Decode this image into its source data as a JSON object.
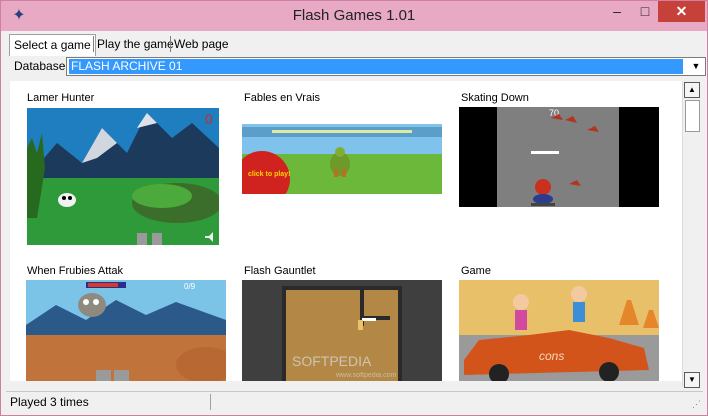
{
  "window": {
    "title": "Flash Games 1.01",
    "app_icon": "star-icon"
  },
  "controls": {
    "minimize": "–",
    "maximize": "□",
    "close": "✕"
  },
  "tabs": [
    {
      "label": "Select a game",
      "active": true
    },
    {
      "label": "Play the game",
      "active": false
    },
    {
      "label": "Web page",
      "active": false
    }
  ],
  "database": {
    "label": "Database",
    "value": "FLASH ARCHIVE 01"
  },
  "games": [
    {
      "title": "Lamer Hunter"
    },
    {
      "title": "Fables en Vrais"
    },
    {
      "title": "Skating Down"
    },
    {
      "title": "When Frubies Attak"
    },
    {
      "title": "Flash Gauntlet"
    },
    {
      "title": "Game"
    }
  ],
  "status": {
    "text": "Played 3 times"
  },
  "watermark": "SOFTPEDIA",
  "watermark_url": "www.softpedia.com",
  "thumb_labels": {
    "clickToPlay": "click to play!"
  },
  "colors": {
    "titlebar": "#e7a9c3",
    "selection": "#3399ff",
    "close": "#c7413b"
  }
}
